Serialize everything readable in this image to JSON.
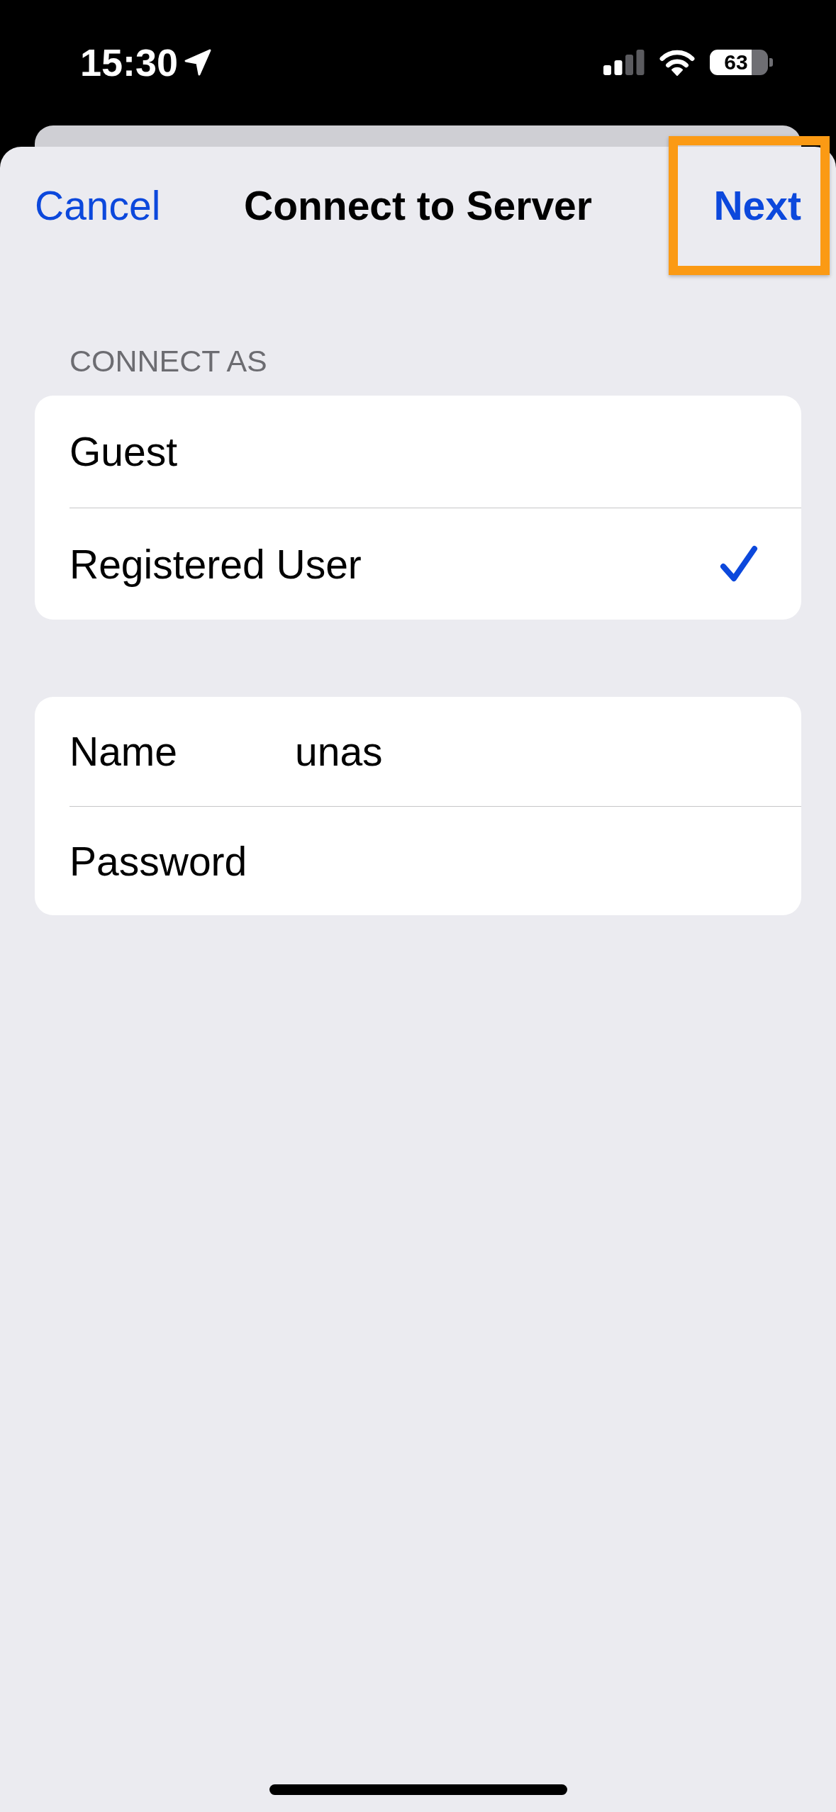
{
  "status_bar": {
    "time": "15:30",
    "battery": "63"
  },
  "header": {
    "cancel": "Cancel",
    "title": "Connect to Server",
    "next": {
      "label": "Next",
      "highlighted": true
    }
  },
  "connect_as": {
    "heading": "CONNECT AS",
    "options": [
      {
        "label": "Guest",
        "selected": false
      },
      {
        "label": "Registered User",
        "selected": true
      }
    ]
  },
  "credentials": [
    {
      "label": "Name",
      "value": "unas"
    },
    {
      "label": "Password"
    }
  ]
}
